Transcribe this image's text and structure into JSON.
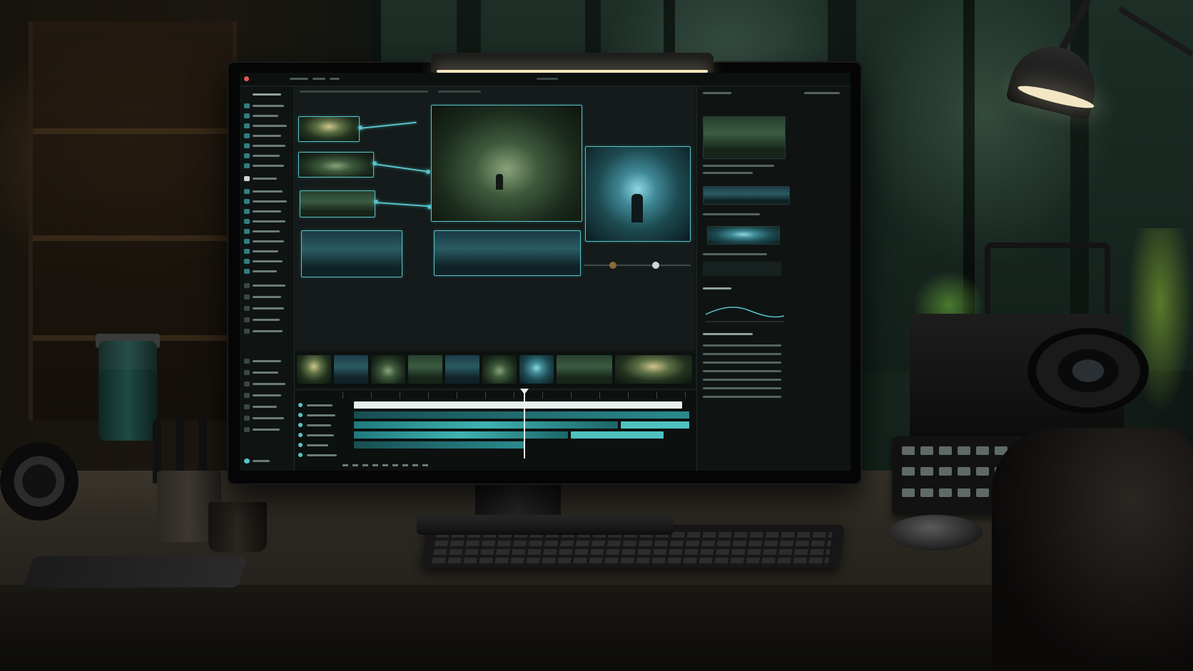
{
  "scene": {
    "description_type": "photograph",
    "monitor_screen": {
      "app_title": "",
      "menu_labels": [],
      "colors": {
        "accent": "#56c4c9",
        "panel": "#0f1413",
        "canvas": "#141b1a",
        "record_dot": "#e0584e"
      }
    }
  }
}
